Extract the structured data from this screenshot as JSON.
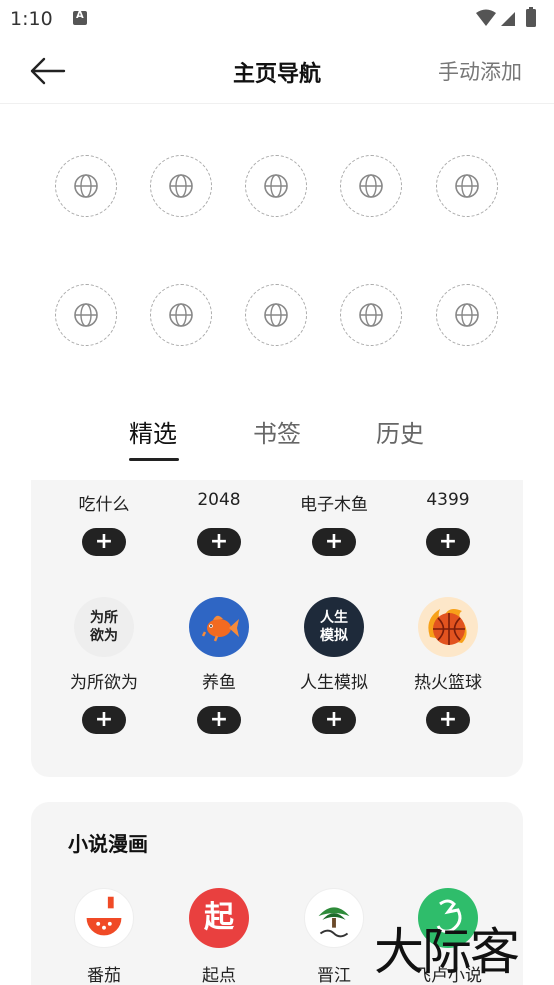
{
  "status_bar": {
    "time": "1:10"
  },
  "header": {
    "title": "主页导航",
    "manual_add": "手动添加"
  },
  "tabs": [
    {
      "label": "精选",
      "active": true
    },
    {
      "label": "书签",
      "active": false
    },
    {
      "label": "历史",
      "active": false
    }
  ],
  "featured": {
    "row1": [
      {
        "label": "吃什么"
      },
      {
        "label": "2048"
      },
      {
        "label": "电子木鱼"
      },
      {
        "label": "4399"
      }
    ],
    "row2": [
      {
        "label": "为所欲为",
        "icon_text": "为所\n欲为"
      },
      {
        "label": "养鱼",
        "icon": "goldfish-icon"
      },
      {
        "label": "人生模拟",
        "icon_text": "人生\n模拟"
      },
      {
        "label": "热火篮球",
        "icon": "basketball-icon"
      }
    ],
    "add_symbol": "+"
  },
  "novel_section": {
    "title": "小说漫画",
    "items": [
      {
        "label": "番茄",
        "icon": "tomato-icon"
      },
      {
        "label": "起点",
        "icon_text": "起"
      },
      {
        "label": "晋江",
        "icon": "jinjiang-icon"
      },
      {
        "label": "飞卢小说",
        "icon": "feilu-icon"
      }
    ]
  },
  "watermark": "大际客",
  "colors": {
    "accent": "#222222",
    "card_bg": "#f5f5f5",
    "qidian_red": "#e9403f",
    "feilu_green": "#2fbd6b",
    "fish_blue": "#2f66c4"
  }
}
